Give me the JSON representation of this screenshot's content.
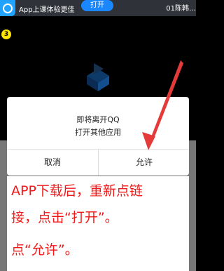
{
  "topbar": {
    "promo_text": "App上课体验更佳",
    "open_button": "打开",
    "user_name": "01陈韩…"
  },
  "badge": "3",
  "dialog": {
    "message_line1": "即将离开QQ",
    "message_line2": "打开其他应用",
    "cancel_label": "取消",
    "allow_label": "允许"
  },
  "instruction": {
    "line1": "APP下载后，重新点链",
    "line2": "接，点击“打开”。",
    "line3": "点“允许”。"
  },
  "colors": {
    "instruction_text": "#f01818",
    "open_button": "#1a87ff",
    "badge": "#ffe400"
  },
  "icons": [
    "app-logo-icon",
    "video-player-logo-icon",
    "red-arrow-icon"
  ]
}
